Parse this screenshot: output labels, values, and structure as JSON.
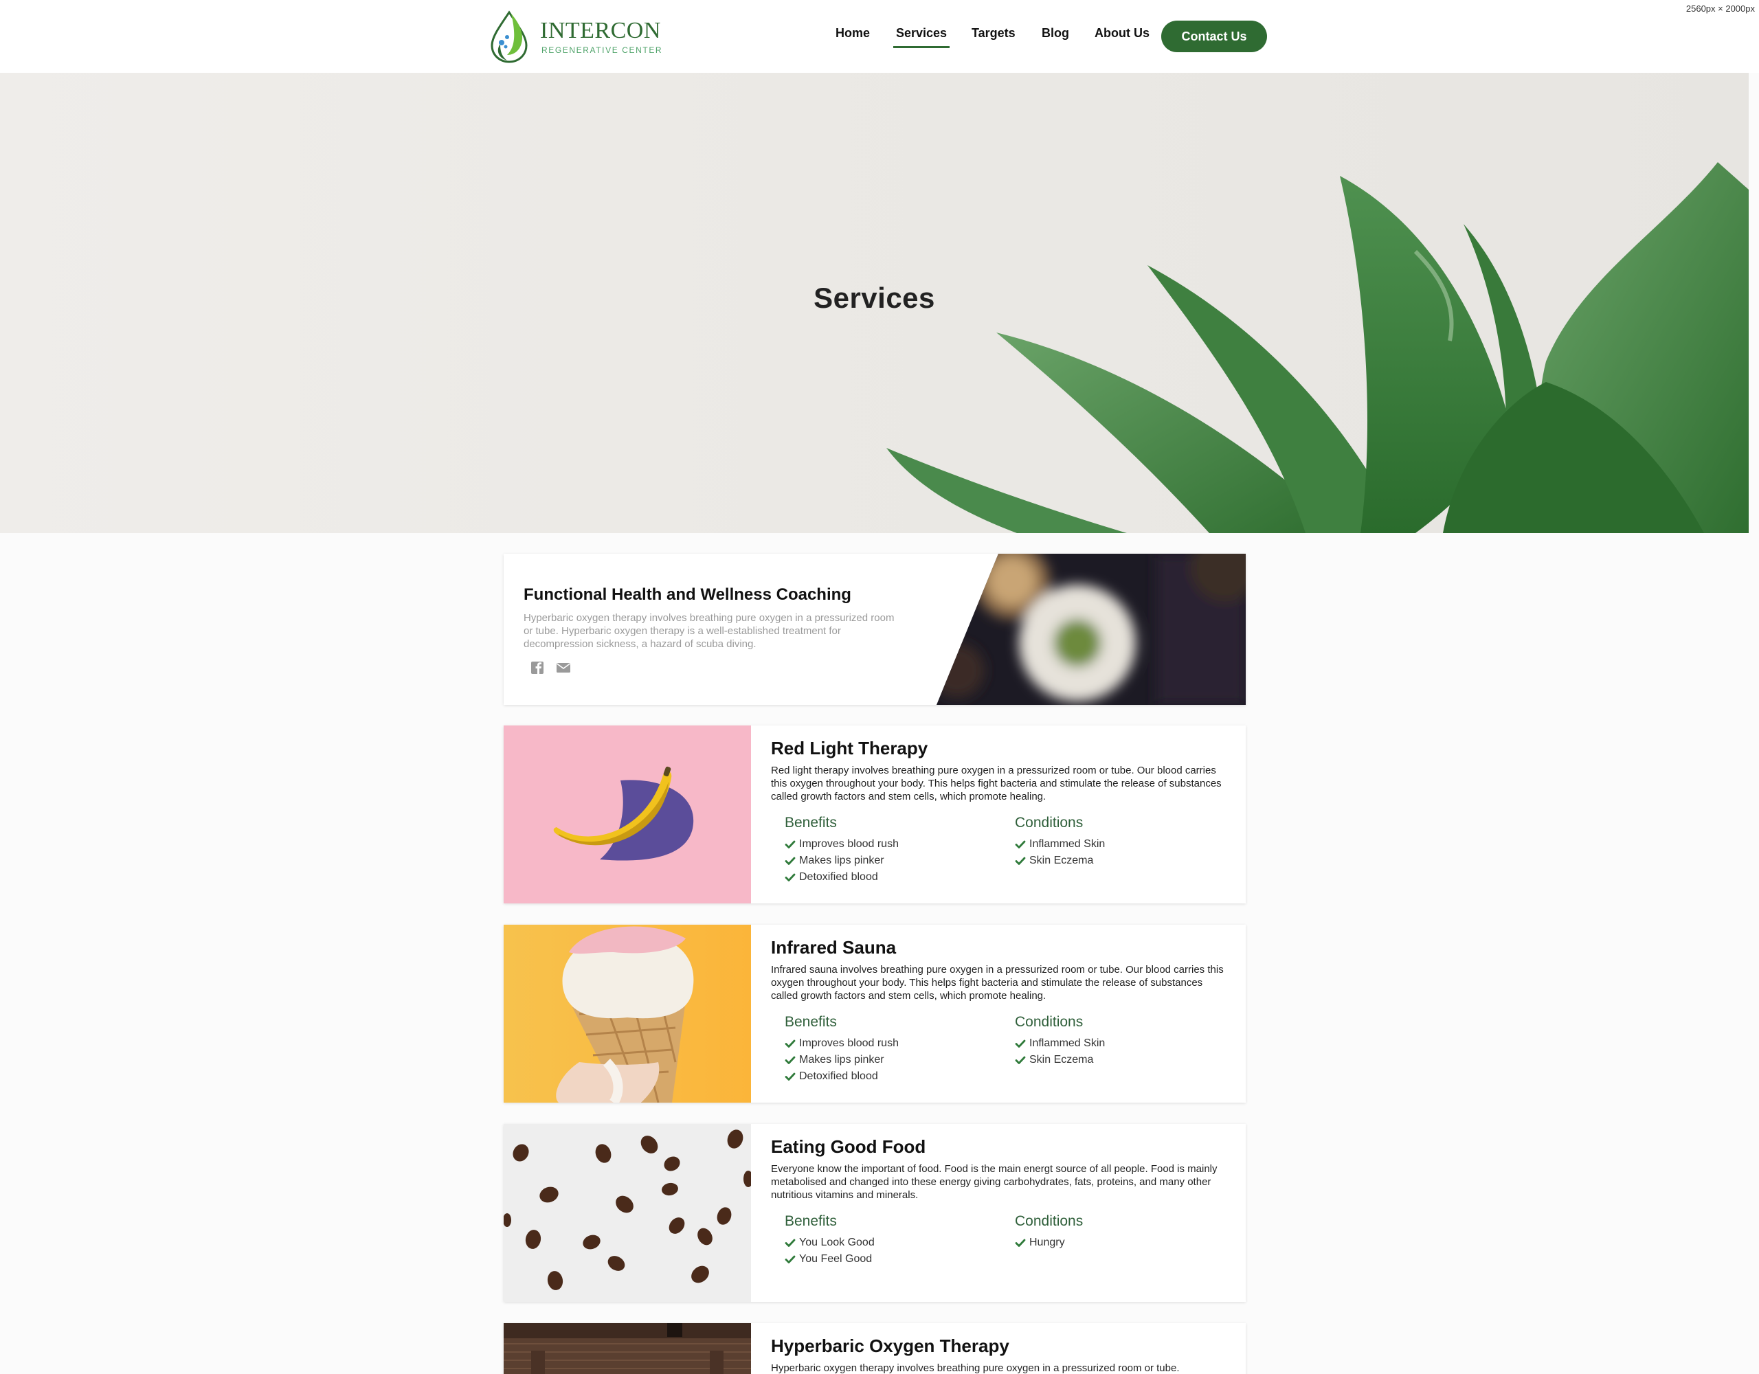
{
  "header": {
    "brand": {
      "name": "INTERCON",
      "tagline": "REGENERATIVE CENTER"
    },
    "nav": [
      {
        "label": "Home",
        "active": false
      },
      {
        "label": "Services",
        "active": true
      },
      {
        "label": "Targets",
        "active": false
      },
      {
        "label": "Blog",
        "active": false
      },
      {
        "label": "About Us",
        "active": false
      }
    ],
    "contact_label": "Contact Us"
  },
  "viewport_note": "2560px × 2000px",
  "hero": {
    "title": "Services"
  },
  "featured": {
    "title": "Functional Health and Wellness Coaching",
    "description": "Hyperbaric oxygen therapy involves breathing pure oxygen in a pressurized room or tube. Hyperbaric oxygen therapy is a well-established treatment for decompression sickness, a hazard of scuba diving.",
    "icons": [
      "facebook-icon",
      "mail-icon"
    ]
  },
  "services": [
    {
      "title": "Red Light Therapy",
      "description": "Red light therapy involves breathing pure oxygen in a pressurized room or tube. Our blood carries this oxygen throughout your body. This helps fight bacteria and stimulate the release of substances called growth factors and stem cells, which promote healing.",
      "benefits_label": "Benefits",
      "benefits": [
        "Improves blood rush",
        "Makes lips pinker",
        "Detoxified blood"
      ],
      "conditions_label": "Conditions",
      "conditions": [
        "Inflammed Skin",
        "Skin Eczema"
      ],
      "image": "banana-on-pink"
    },
    {
      "title": "Infrared Sauna",
      "description": "Infrared sauna involves breathing pure oxygen in a pressurized room or tube. Our blood carries this oxygen throughout your body. This helps fight bacteria and stimulate the release of substances called growth factors and stem cells, which promote healing.",
      "benefits_label": "Benefits",
      "benefits": [
        "Improves blood rush",
        "Makes lips pinker",
        "Detoxified blood"
      ],
      "conditions_label": "Conditions",
      "conditions": [
        "Inflammed Skin",
        "Skin Eczema"
      ],
      "image": "ice-cream-cone-on-yellow"
    },
    {
      "title": "Eating Good Food",
      "description": "Everyone know the important of food. Food is the main energt source of all people. Food is mainly metabolised and changed into these energy giving carbohydrates, fats, proteins, and many other nutritious vitamins and minerals.",
      "benefits_label": "Benefits",
      "benefits": [
        "You Look Good",
        "You Feel Good"
      ],
      "conditions_label": "Conditions",
      "conditions": [
        "Hungry"
      ],
      "image": "coffee-beans-on-white"
    },
    {
      "title": "Hyperbaric Oxygen Therapy",
      "description": "Hyperbaric oxygen therapy involves breathing pure oxygen in a pressurized room or tube.",
      "image": "wooden-sauna-room"
    }
  ],
  "colors": {
    "brand_green": "#2f6b32",
    "check_green": "#2f7a3a",
    "heading_green": "#2f5f3a"
  }
}
